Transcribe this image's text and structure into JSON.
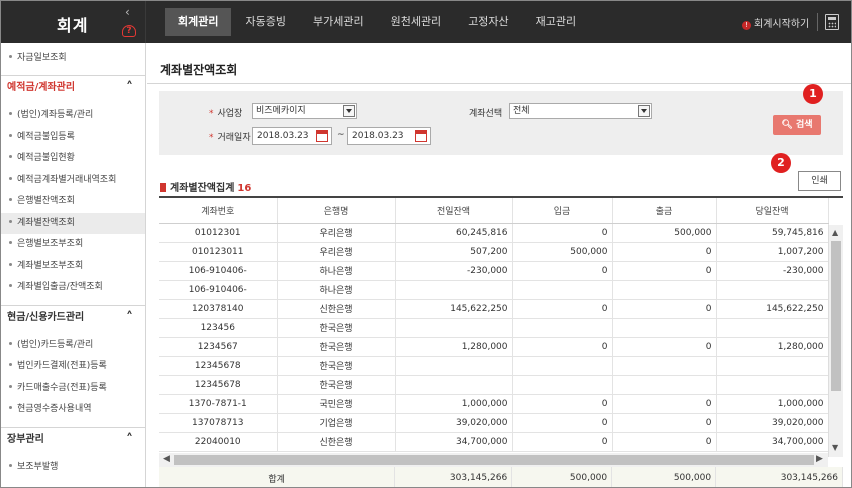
{
  "app": {
    "logo": "회계",
    "collapse_icon": "chevron-left-icon",
    "help_icon": "headset-help-icon",
    "help_label": "?",
    "nav": [
      "회계관리",
      "자동증빙",
      "부가세관리",
      "원천세관리",
      "고정자산",
      "재고관리"
    ],
    "start_link": "회계시작하기",
    "start_mark": "!",
    "calculator_icon": "calculator-icon"
  },
  "sidebar": {
    "top_item": "자금일보조회",
    "sections": [
      {
        "title": "예적금/계좌관리",
        "items": [
          "(법인)계좌등록/관리",
          "예적금불입등록",
          "예적금불입현황",
          "예적금계좌별거래내역조회",
          "은행별잔액조회",
          "계좌별잔액조회",
          "은행별보조부조회",
          "계좌별보조부조회",
          "계좌별입출금/잔액조회"
        ]
      },
      {
        "title": "현금/신용카드관리",
        "items": [
          "(법인)카드등록/관리",
          "법인카드결제(전표)등록",
          "카드매출수금(전표)등록",
          "현금영수증사용내역"
        ]
      },
      {
        "title": "장부관리",
        "items": [
          "보조부발행"
        ]
      }
    ]
  },
  "page": {
    "title": "계좌별잔액조회",
    "filters": {
      "business_label": "사업장",
      "business_value": "비즈메카이지",
      "account_label": "계좌선택",
      "account_value": "전체",
      "date_label": "거래일자",
      "date_from": "2018.03.23",
      "date_to": "2018.03.23",
      "required_mark": "*",
      "range_sep": "~"
    },
    "search_button": "검색",
    "print_button": "인쇄",
    "badges": [
      "1",
      "2"
    ],
    "section_title": "계좌별잔액집계",
    "count": "16"
  },
  "table": {
    "headers": [
      "계좌번호",
      "은행명",
      "전일잔액",
      "입금",
      "출금",
      "당일잔액"
    ],
    "rows": [
      [
        "01012301",
        "우리은행",
        "60,245,816",
        "0",
        "500,000",
        "59,745,816"
      ],
      [
        "010123011",
        "우리은행",
        "507,200",
        "500,000",
        "0",
        "1,007,200"
      ],
      [
        "106-910406-",
        "하나은행",
        "-230,000",
        "0",
        "0",
        "-230,000"
      ],
      [
        "106-910406-",
        "하나은행",
        "",
        "",
        "",
        ""
      ],
      [
        "120378140",
        "신한은행",
        "145,622,250",
        "0",
        "0",
        "145,622,250"
      ],
      [
        "123456",
        "한국은행",
        "",
        "",
        "",
        ""
      ],
      [
        "1234567",
        "한국은행",
        "1,280,000",
        "0",
        "0",
        "1,280,000"
      ],
      [
        "12345678",
        "한국은행",
        "",
        "",
        "",
        ""
      ],
      [
        "12345678",
        "한국은행",
        "",
        "",
        "",
        ""
      ],
      [
        "1370-7871-1",
        "국민은행",
        "1,000,000",
        "0",
        "0",
        "1,000,000"
      ],
      [
        "137078713",
        "기업은행",
        "39,020,000",
        "0",
        "0",
        "39,020,000"
      ],
      [
        "22040010",
        "신한은행",
        "34,700,000",
        "0",
        "0",
        "34,700,000"
      ]
    ],
    "total": [
      "합계",
      "303,145,266",
      "500,000",
      "500,000",
      "303,145,266"
    ]
  },
  "colors": {
    "accent": "#d0362f",
    "search_button": "#e8786f",
    "badge": "#e02020",
    "topbar": "#2b2b2b"
  }
}
